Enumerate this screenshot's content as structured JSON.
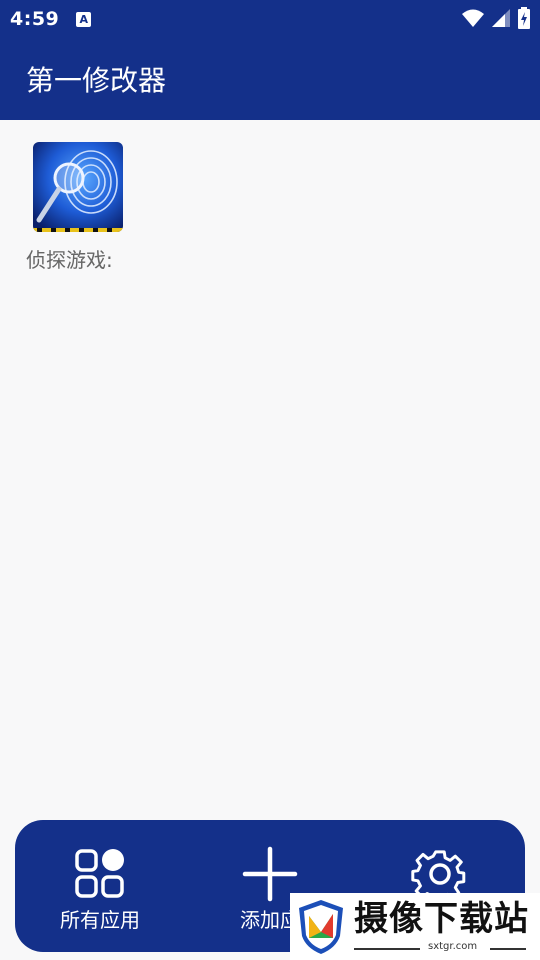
{
  "status_bar": {
    "time": "4:59",
    "notification_icon": "A",
    "icons": [
      "wifi-icon",
      "signal-icon",
      "battery-charging-icon"
    ]
  },
  "app_bar": {
    "title": "第一修改器"
  },
  "apps": [
    {
      "label": "侦探游戏:",
      "icon": "fingerprint-magnifier-icon"
    }
  ],
  "bottom_nav": {
    "items": [
      {
        "label": "所有应用",
        "icon": "apps-grid-icon"
      },
      {
        "label": "添加应",
        "icon": "plus-icon"
      },
      {
        "label": "",
        "icon": "gear-icon"
      }
    ]
  },
  "watermark": {
    "title": "摄像下载站",
    "url": "sxtgr.com"
  },
  "colors": {
    "primary": "#14308a",
    "background": "#f8f8f9",
    "label": "#666666"
  }
}
